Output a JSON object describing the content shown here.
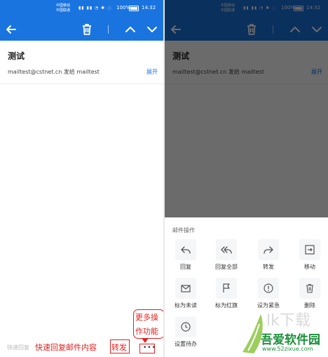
{
  "status_bar": {
    "carrier_1": "中国移动",
    "carrier_2": "中国联通",
    "battery": "100%",
    "time": "14:32"
  },
  "email": {
    "subject": "测试",
    "from_line": "mailtest@cstnet.cn 发给 mailtest",
    "expand_label": "展开"
  },
  "reply_bar": {
    "placeholder": "快速回复",
    "more_label": "•••"
  },
  "annotations": {
    "quick_reply": "快速回复邮件内容",
    "forward": "转发",
    "more_line1": "更多操",
    "more_line2": "作功能"
  },
  "action_sheet": {
    "title": "邮件操作",
    "actions": [
      {
        "label": "回复",
        "icon": "reply-icon"
      },
      {
        "label": "回复全部",
        "icon": "reply-all-icon"
      },
      {
        "label": "转发",
        "icon": "forward-icon"
      },
      {
        "label": "移动",
        "icon": "move-icon"
      },
      {
        "label": "标为未读",
        "icon": "mail-unread-icon"
      },
      {
        "label": "标为红旗",
        "icon": "flag-icon"
      },
      {
        "label": "设为紧急",
        "icon": "urgent-icon"
      },
      {
        "label": "删除",
        "icon": "trash-icon"
      },
      {
        "label": "设置待办",
        "icon": "clock-icon"
      }
    ]
  },
  "watermark": {
    "text": "吾爱软件园",
    "url": "www.52zixue.com"
  },
  "colors": {
    "accent": "#1a74e0",
    "annotation": "#e02020"
  }
}
